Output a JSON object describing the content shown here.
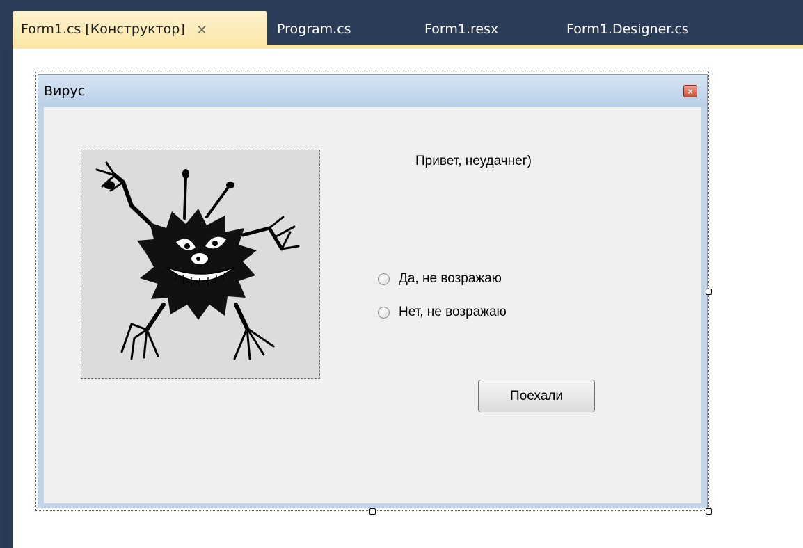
{
  "ide": {
    "tabs": [
      {
        "label": "Form1.cs [Конструктор]",
        "active": true,
        "close_icon": "×"
      },
      {
        "label": "Program.cs",
        "active": false
      },
      {
        "label": "Form1.resx",
        "active": false
      },
      {
        "label": "Form1.Designer.cs",
        "active": false
      }
    ],
    "colors": {
      "tab_strip": "#2b3c59",
      "active_tab": "#fbe6a6"
    }
  },
  "form": {
    "title": "Вирус",
    "close_icon": "close-icon",
    "picture_icon": "monster-icon",
    "greeting": "Привет, неудачнег)",
    "radios": [
      {
        "label": "Да, не возражаю",
        "checked": false
      },
      {
        "label": "Нет, не возражаю",
        "checked": false
      }
    ],
    "button_label": "Поехали"
  }
}
